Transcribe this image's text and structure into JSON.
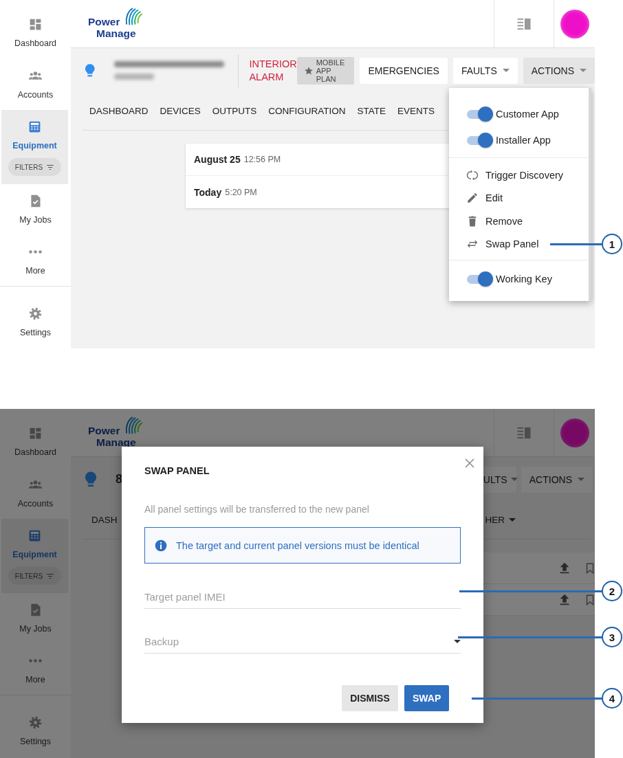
{
  "screen_1": {
    "sidebar": {
      "items": [
        {
          "label": "Dashboard",
          "selected": false
        },
        {
          "label": "Accounts",
          "selected": false
        },
        {
          "label": "Equipment",
          "selected": true,
          "filter": "FILTERS"
        },
        {
          "label": "My Jobs",
          "selected": false
        },
        {
          "label": "More",
          "selected": false
        }
      ],
      "settings": {
        "label": "Settings"
      }
    },
    "logo": {
      "line_1": "Power",
      "line_2": "Manage"
    },
    "panel": {
      "status": "INTERIOR ALARM",
      "plan": "MOBILE APP PLAN"
    },
    "buttons": [
      {
        "label": "EMERGENCIES",
        "dropdown": false,
        "selected": false
      },
      {
        "label": "FAULTS",
        "dropdown": true,
        "selected": false
      },
      {
        "label": "ACTIONS",
        "dropdown": true,
        "selected": true
      }
    ],
    "tabs": [
      {
        "label": "DASHBOARD",
        "selected": false
      },
      {
        "label": "DEVICES",
        "selected": false
      },
      {
        "label": "OUTPUTS",
        "selected": false
      },
      {
        "label": "CONFIGURATION",
        "selected": false
      },
      {
        "label": "STATE",
        "selected": false
      },
      {
        "label": "EVENTS",
        "selected": false
      }
    ],
    "events": [
      {
        "date": "August 25",
        "time": "12:56 PM"
      },
      {
        "date": "Today",
        "time": "5:20 PM"
      }
    ],
    "actions_menu": {
      "items": [
        {
          "kind": "toggle",
          "label": "Customer App",
          "on": true
        },
        {
          "kind": "toggle",
          "label": "Installer App",
          "on": true
        },
        {
          "kind": "divider"
        },
        {
          "kind": "action",
          "label": "Trigger Discovery"
        },
        {
          "kind": "action",
          "label": "Edit"
        },
        {
          "kind": "action",
          "label": "Remove"
        },
        {
          "kind": "action",
          "label": "Swap Panel"
        },
        {
          "kind": "divider"
        },
        {
          "kind": "toggle",
          "label": "Working Key",
          "on": true
        }
      ]
    }
  },
  "screen_2": {
    "sidebar": {
      "items": [
        {
          "label": "Dashboard",
          "selected": false
        },
        {
          "label": "Accounts",
          "selected": false
        },
        {
          "label": "Equipment",
          "selected": true,
          "filter": "FILTERS"
        },
        {
          "label": "My Jobs",
          "selected": false
        },
        {
          "label": "More",
          "selected": false
        }
      ],
      "settings": {
        "label": "Settings"
      }
    },
    "logo": {
      "line_1": "Power",
      "line_2": "Manage"
    },
    "panel_id": "8",
    "buttons": [
      {
        "label": "ULTS",
        "dropdown": true,
        "selected": false
      },
      {
        "label": "ACTIONS",
        "dropdown": true,
        "selected": false
      }
    ],
    "tabs": [
      {
        "label": "DASH",
        "selected": false
      },
      {
        "label": "HER",
        "dropdown": true,
        "selected": false
      }
    ],
    "dialog": {
      "title": "SWAP PANEL",
      "description": "All panel settings will be transferred to the new panel",
      "notice": "The target and current panel versions must be identical",
      "fields": [
        {
          "kind": "text",
          "placeholder": "Target panel IMEI"
        },
        {
          "kind": "select",
          "placeholder": "Backup"
        }
      ],
      "buttons": [
        {
          "kind": "secondary",
          "label": "DISMISS"
        },
        {
          "kind": "primary",
          "label": "SWAP"
        }
      ]
    }
  },
  "callouts": [
    {
      "number": "1"
    },
    {
      "number": "2"
    },
    {
      "number": "3"
    },
    {
      "number": "4"
    }
  ]
}
